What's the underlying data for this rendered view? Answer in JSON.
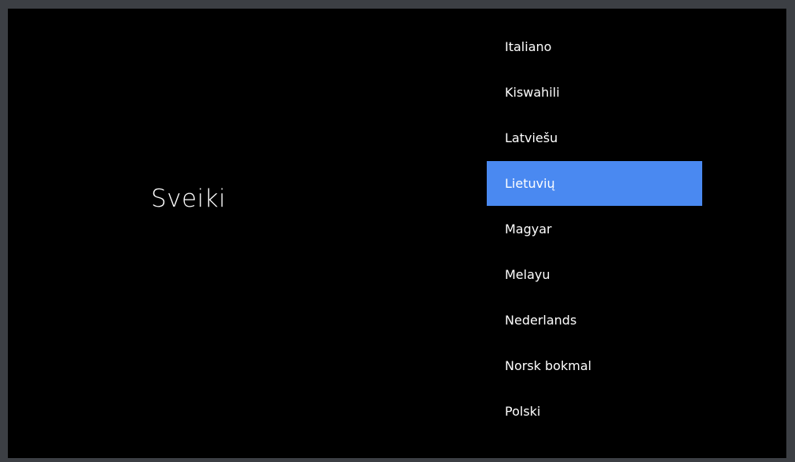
{
  "greeting": "Sveiki",
  "languages": [
    {
      "label": "Italiano",
      "selected": false
    },
    {
      "label": "Kiswahili",
      "selected": false
    },
    {
      "label": "Latviešu",
      "selected": false
    },
    {
      "label": "Lietuvių",
      "selected": true
    },
    {
      "label": "Magyar",
      "selected": false
    },
    {
      "label": "Melayu",
      "selected": false
    },
    {
      "label": "Nederlands",
      "selected": false
    },
    {
      "label": "Norsk bokmal",
      "selected": false
    },
    {
      "label": "Polski",
      "selected": false
    }
  ],
  "colors": {
    "background": "#000000",
    "selection": "#4a89f1",
    "bezel": "#3c3f44",
    "text": "#ffffff"
  }
}
